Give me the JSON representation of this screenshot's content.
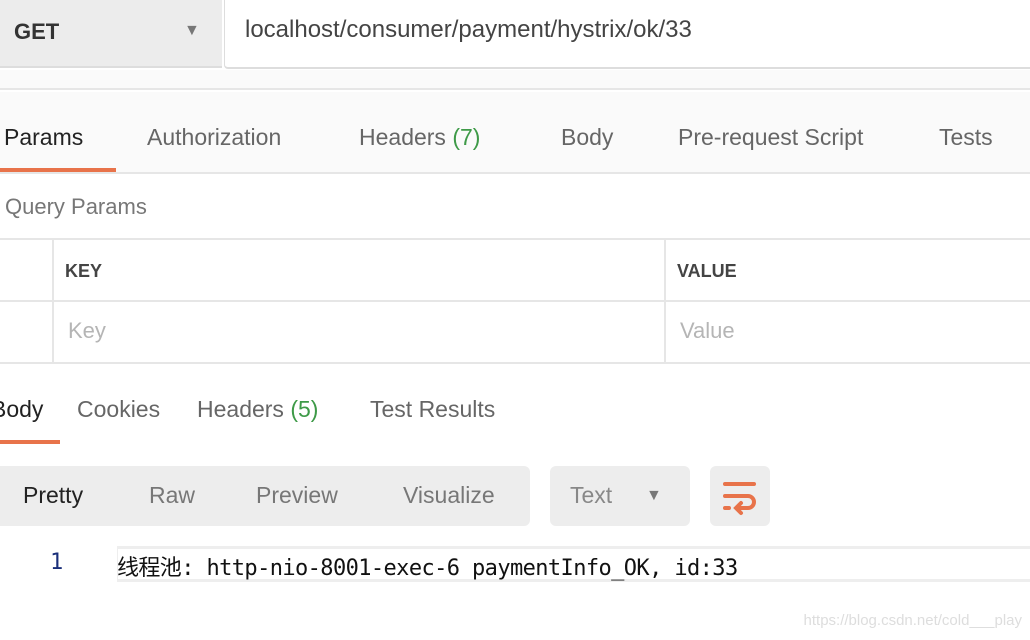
{
  "request": {
    "method": "GET",
    "url": "localhost/consumer/payment/hystrix/ok/33"
  },
  "request_tabs": [
    {
      "label": "Params",
      "active": true
    },
    {
      "label": "Authorization"
    },
    {
      "label": "Headers",
      "count": "(7)"
    },
    {
      "label": "Body"
    },
    {
      "label": "Pre-request Script"
    },
    {
      "label": "Tests"
    }
  ],
  "query_params": {
    "title": "Query Params",
    "key_header": "KEY",
    "value_header": "VALUE",
    "key_placeholder": "Key",
    "value_placeholder": "Value"
  },
  "response_tabs": [
    {
      "label": "Body",
      "active": true
    },
    {
      "label": "Cookies"
    },
    {
      "label": "Headers",
      "count": "(5)"
    },
    {
      "label": "Test Results"
    }
  ],
  "view_modes": [
    "Pretty",
    "Raw",
    "Preview",
    "Visualize"
  ],
  "format": {
    "selected": "Text"
  },
  "response_body": [
    {
      "line": "1",
      "text": "线程池: http-nio-8001-exec-6 paymentInfo_OK, id:33"
    }
  ],
  "watermark": "https://blog.csdn.net/cold___play",
  "colors": {
    "accent": "#e8734a",
    "count": "#3e9a48"
  }
}
